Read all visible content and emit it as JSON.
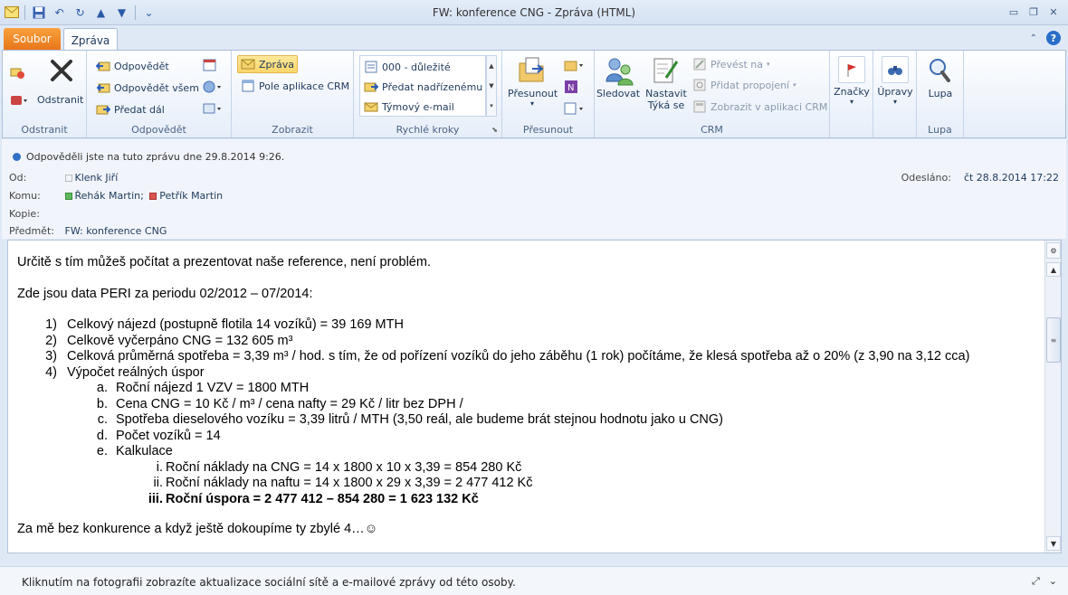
{
  "window": {
    "title": "FW: konference CNG  -  Zpráva (HTML)"
  },
  "tabs": {
    "file": "Soubor",
    "message": "Zpráva"
  },
  "ribbon": {
    "delete_group": {
      "label": "Odstranit",
      "delete_button": "Odstranit"
    },
    "respond_group": {
      "label": "Odpovědět",
      "reply": "Odpovědět",
      "reply_all": "Odpovědět všem",
      "forward": "Předat dál"
    },
    "show_group": {
      "label": "Zobrazit",
      "message": "Zpráva",
      "crm_fields": "Pole aplikace CRM"
    },
    "quick_steps": {
      "label": "Rychlé kroky",
      "items": [
        "000 - důležité",
        "Předat nadřízenému",
        "Týmový e-mail"
      ]
    },
    "move_group": {
      "label": "Přesunout",
      "move": "Přesunout"
    },
    "crm_group": {
      "label": "CRM",
      "follow": "Sledovat",
      "set_regarding_1": "Nastavit",
      "set_regarding_2": "Týká se",
      "convert": "Převést na",
      "add_link": "Přidat propojení",
      "view_in_crm": "Zobrazit v aplikaci CRM"
    },
    "tags_group": {
      "tags": "Značky"
    },
    "edit_group": {
      "edit": "Úpravy"
    },
    "zoom_group": {
      "label": "Lupa",
      "zoom": "Lupa"
    }
  },
  "header": {
    "info": "Odpověděli jste na tuto zprávu dne 29.8.2014 9:26.",
    "from_label": "Od:",
    "from": "Klenk Jiří",
    "to_label": "Komu:",
    "to_1": "Řehák Martin;",
    "to_2": "Petřík Martin",
    "cc_label": "Kopie:",
    "subject_label": "Předmět:",
    "subject": "FW: konference CNG",
    "sent_label": "Odesláno:",
    "sent": "čt 28.8.2014 17:22"
  },
  "body": {
    "p1": "Určitě s tím můžeš počítat a prezentovat naše reference, není problém.",
    "p2": "Zde jsou data PERI za periodu 02/2012 – 07/2014:",
    "list": [
      {
        "n": "1)",
        "text": "Celkový nájezd (postupně flotila 14 vozíků) = 39 169 MTH"
      },
      {
        "n": "2)",
        "text": "Celkově vyčerpáno CNG = 132 605 m³"
      },
      {
        "n": "3)",
        "text": "Celková průměrná spotřeba = 3,39 m³ / hod. s tím, že od pořízení vozíků do jeho záběhu (1 rok) počítáme, že klesá spotřeba až o 20% (z 3,90 na 3,12 cca)"
      },
      {
        "n": "4)",
        "text": "Výpočet reálných úspor"
      }
    ],
    "sub": [
      {
        "n": "a.",
        "text": "Roční nájezd 1 VZV = 1800 MTH"
      },
      {
        "n": "b.",
        "text": "Cena CNG = 10 Kč / m³ / cena nafty = 29 Kč / litr bez DPH /"
      },
      {
        "n": "c.",
        "text": "Spotřeba dieselového vozíku = 3,39 litrů / MTH (3,50 reál, ale budeme brát stejnou hodnotu jako u CNG)"
      },
      {
        "n": "d.",
        "text": "Počet vozíků = 14"
      },
      {
        "n": "e.",
        "text": "Kalkulace"
      }
    ],
    "subsub": [
      {
        "n": "i.",
        "text": "Roční náklady na CNG = 14 x 1800 x 10 x 3,39 = 854 280 Kč"
      },
      {
        "n": "ii.",
        "text": "Roční náklady na naftu = 14 x 1800 x 29 x 3,39 = 2 477 412 Kč"
      },
      {
        "n": "iii.",
        "text": "Roční úspora = 2 477 412 – 854 280 = 1 623 132 Kč"
      }
    ],
    "closing": "Za mě bez konkurence a když ještě dokoupíme ty zbylé 4…☺"
  },
  "status": {
    "text": "Kliknutím na fotografii zobrazíte aktualizace sociální sítě a e-mailové zprávy od této osoby."
  },
  "colors": {
    "file_tab": "#e9761b",
    "accent_blue": "#2a6ec9",
    "ribbon_bg": "#e6eef9"
  }
}
